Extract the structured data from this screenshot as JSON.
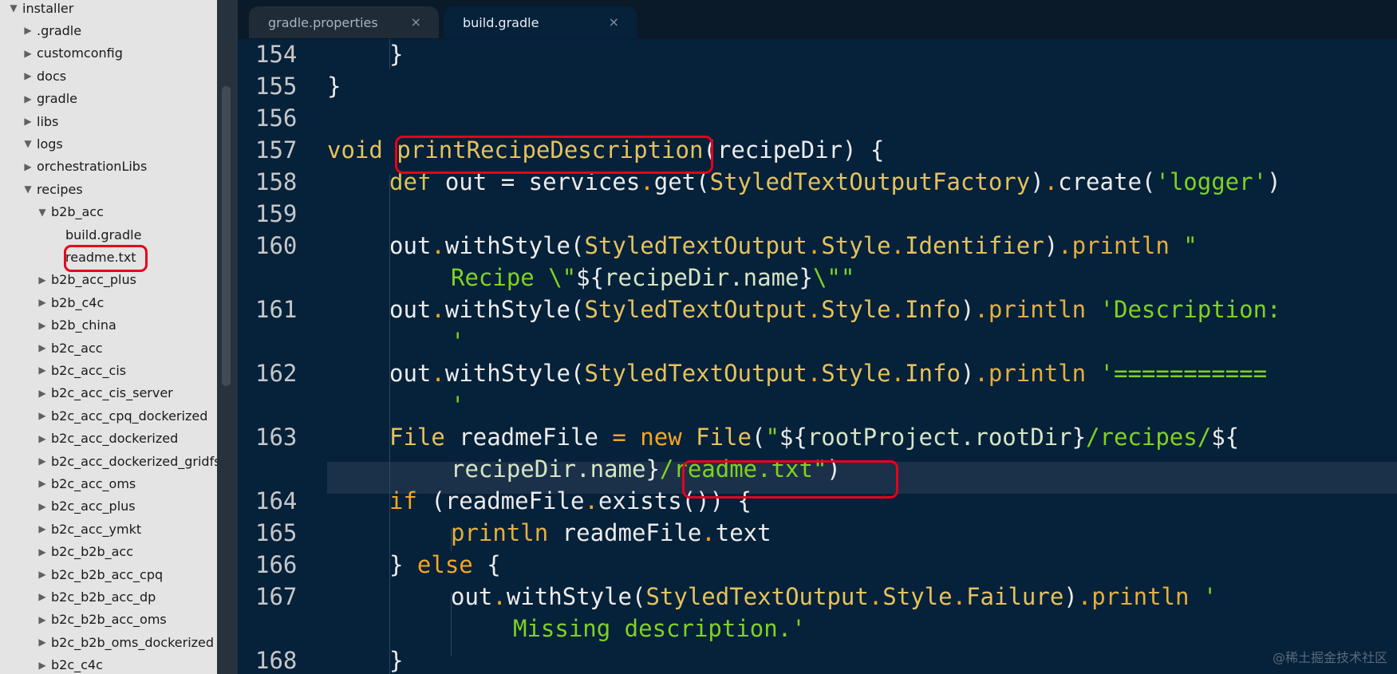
{
  "sidebar": {
    "items": [
      {
        "label": "installer",
        "arrow": "▼"
      },
      {
        "label": ".gradle",
        "arrow": "▶"
      },
      {
        "label": "customconfig",
        "arrow": "▶"
      },
      {
        "label": "docs",
        "arrow": "▶"
      },
      {
        "label": "gradle",
        "arrow": "▶"
      },
      {
        "label": "libs",
        "arrow": "▶"
      },
      {
        "label": "logs",
        "arrow": "▼"
      },
      {
        "label": "orchestrationLibs",
        "arrow": "▶"
      },
      {
        "label": "recipes",
        "arrow": "▼"
      },
      {
        "label": "b2b_acc",
        "arrow": "▼"
      },
      {
        "label": "build.gradle",
        "arrow": ""
      },
      {
        "label": "readme.txt",
        "arrow": ""
      },
      {
        "label": "b2b_acc_plus",
        "arrow": "▶"
      },
      {
        "label": "b2b_c4c",
        "arrow": "▶"
      },
      {
        "label": "b2b_china",
        "arrow": "▶"
      },
      {
        "label": "b2c_acc",
        "arrow": "▶"
      },
      {
        "label": "b2c_acc_cis",
        "arrow": "▶"
      },
      {
        "label": "b2c_acc_cis_server",
        "arrow": "▶"
      },
      {
        "label": "b2c_acc_cpq_dockerized",
        "arrow": "▶"
      },
      {
        "label": "b2c_acc_dockerized",
        "arrow": "▶"
      },
      {
        "label": "b2c_acc_dockerized_gridfs",
        "arrow": "▶"
      },
      {
        "label": "b2c_acc_oms",
        "arrow": "▶"
      },
      {
        "label": "b2c_acc_plus",
        "arrow": "▶"
      },
      {
        "label": "b2c_acc_ymkt",
        "arrow": "▶"
      },
      {
        "label": "b2c_b2b_acc",
        "arrow": "▶"
      },
      {
        "label": "b2c_b2b_acc_cpq",
        "arrow": "▶"
      },
      {
        "label": "b2c_b2b_acc_dp",
        "arrow": "▶"
      },
      {
        "label": "b2c_b2b_acc_oms",
        "arrow": "▶"
      },
      {
        "label": "b2c_b2b_oms_dockerized",
        "arrow": "▶"
      },
      {
        "label": "b2c_c4c",
        "arrow": "▶"
      }
    ]
  },
  "tabs": [
    {
      "label": "gradle.properties",
      "close": "×"
    },
    {
      "label": "build.gradle",
      "close": "×"
    }
  ],
  "editor": {
    "line_numbers": [
      "154",
      "155",
      "156",
      "157",
      "158",
      "159",
      "160",
      "161",
      "162",
      "163",
      "164",
      "165",
      "166",
      "167",
      "168"
    ]
  },
  "code": {
    "l154": "}",
    "l155": "}",
    "l157_void": "void ",
    "l157_fn": "printRecipeDescription",
    "l157_rest": "(recipeDir) {",
    "l158_def": "def",
    "l158_a": " out = services",
    "l158_dot": ".",
    "l158_get": "get",
    "l158_b": "(",
    "l158_cls": "StyledTextOutputFactory",
    "l158_c": ")",
    "l158_dot2": ".",
    "l158_create": "create",
    "l158_d": "(",
    "l158_str": "'logger'",
    "l158_e": ")",
    "l160_a": "out",
    "l160_dot": ".",
    "l160_b": "withStyle(",
    "l160_cls": "StyledTextOutput",
    "l160_dot2": ".",
    "l160_cls2": "Style",
    "l160_dot3": ".",
    "l160_cls3": "Identifier",
    "l160_c": ")",
    "l160_dot4": ".",
    "l160_println": "println",
    "l160_str": " \"",
    "l160w_str1": "Recipe \\\"",
    "l160w_interp": "${",
    "l160w_var": "recipeDir.name",
    "l160w_interp2": "}",
    "l160w_str2": "\\\"\"",
    "l161_a": "out",
    "l161_dot": ".",
    "l161_b": "withStyle(",
    "l161_cls": "StyledTextOutput",
    "l161_dot2": ".",
    "l161_cls2": "Style",
    "l161_dot3": ".",
    "l161_cls3": "Info",
    "l161_c": ")",
    "l161_dot4": ".",
    "l161_println": "println",
    "l161_str": " 'Description:",
    "l161w_str": "'",
    "l162_a": "out",
    "l162_dot": ".",
    "l162_b": "withStyle(",
    "l162_cls": "StyledTextOutput",
    "l162_dot2": ".",
    "l162_cls2": "Style",
    "l162_dot3": ".",
    "l162_cls3": "Info",
    "l162_c": ")",
    "l162_dot4": ".",
    "l162_println": "println",
    "l162_str": " '===========",
    "l162w_str": "'",
    "l163_cls": "File",
    "l163_a": " readmeFile ",
    "l163_eq": "=",
    "l163_new": " new ",
    "l163_cls2": "File",
    "l163_b": "(",
    "l163_q": "\"",
    "l163_interp": "${",
    "l163_var": "rootProject.rootDir",
    "l163_interp2": "}",
    "l163_str": "/recipes/",
    "l163_interp3": "${",
    "l163w_var": "recipeDir.name",
    "l163w_interp": "}",
    "l163w_str": "/readme.txt\"",
    "l163w_c": ")",
    "l164_if": "if",
    "l164_a": " (readmeFile",
    "l164_dot": ".",
    "l164_b": "exists()) {",
    "l165_println": "println",
    "l165_a": " readmeFile",
    "l165_dot": ".",
    "l165_b": "text",
    "l166_a": "} ",
    "l166_else": "else",
    "l166_b": " {",
    "l167_a": "out",
    "l167_dot": ".",
    "l167_b": "withStyle(",
    "l167_cls": "StyledTextOutput",
    "l167_dot2": ".",
    "l167_cls2": "Style",
    "l167_dot3": ".",
    "l167_cls3": "Failure",
    "l167_c": ")",
    "l167_dot4": ".",
    "l167_println": "println",
    "l167_str": " '",
    "l167w_str": "Missing description.'",
    "l168": "}"
  },
  "watermark": "@稀土掘金技术社区"
}
